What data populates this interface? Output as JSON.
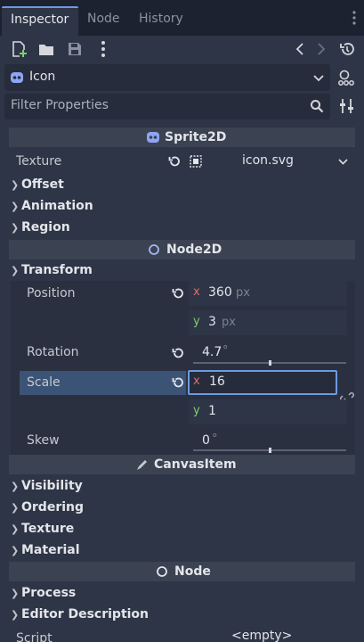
{
  "tabs": [
    {
      "label": "Inspector",
      "active": true
    },
    {
      "label": "Node",
      "active": false
    },
    {
      "label": "History",
      "active": false
    }
  ],
  "toolbar": {
    "icons": [
      "new-resource-icon",
      "open-folder-icon",
      "save-icon",
      "more-vert-icon",
      "history-back-icon",
      "history-forward-icon",
      "object-history-icon"
    ]
  },
  "object_selector": {
    "value": "Icon",
    "icon": "godot-icon"
  },
  "filter": {
    "placeholder": "Filter Properties"
  },
  "sections": {
    "sprite2d": "Sprite2D",
    "node2d": "Node2D",
    "canvasitem": "CanvasItem",
    "node": "Node"
  },
  "texture": {
    "label": "Texture",
    "value": "icon.svg"
  },
  "sprite_categories": [
    "Offset",
    "Animation",
    "Region"
  ],
  "transform": {
    "label": "Transform",
    "position": {
      "label": "Position",
      "x_axis": "x",
      "x": "360",
      "x_unit": "px",
      "y_axis": "y",
      "y": "3",
      "y_unit": "px"
    },
    "rotation": {
      "label": "Rotation",
      "value": "4.7",
      "unit": "°",
      "slider_fraction": 0.5
    },
    "scale": {
      "label": "Scale",
      "x_axis": "x",
      "x": "16",
      "y_axis": "y",
      "y": "1"
    },
    "skew": {
      "label": "Skew",
      "value": "0",
      "unit": "°",
      "slider_fraction": 0.5
    }
  },
  "canvas_categories": [
    "Visibility",
    "Ordering",
    "Texture",
    "Material"
  ],
  "node_categories": [
    "Process",
    "Editor Description"
  ],
  "script": {
    "label": "Script",
    "value": "<empty>"
  },
  "colors": {
    "accent": "#6d9be0",
    "x_axis": "#e06b6b",
    "y_axis": "#7fcf6d",
    "node2d_icon": "#a5b7f3",
    "sprite_icon": "#8da5f3"
  }
}
